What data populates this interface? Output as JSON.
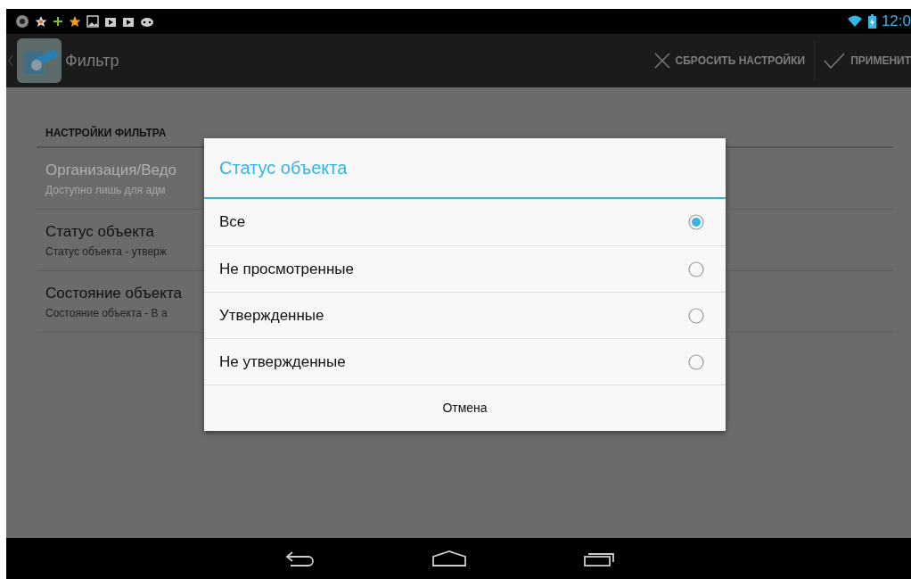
{
  "status_bar": {
    "time": "12:0"
  },
  "action_bar": {
    "title": "Фильтр",
    "actions": [
      {
        "kind": "reset",
        "label": "СБРОСИТЬ НАСТРОЙКИ"
      },
      {
        "kind": "apply",
        "label": "ПРИМЕНИТ"
      }
    ]
  },
  "settings": {
    "header": "НАСТРОЙКИ ФИЛЬТРА",
    "items": [
      {
        "title": "Организация/Ведо",
        "summary": "Доступно лишь для адм",
        "disabled": true
      },
      {
        "title": "Статус объекта",
        "summary": "Статус объекта - утверж",
        "disabled": false
      },
      {
        "title": "Состояние объекта",
        "summary": "Состояние объекта - В а",
        "disabled": false
      }
    ]
  },
  "dialog": {
    "title": "Статус объекта",
    "options": [
      {
        "label": "Все",
        "selected": true
      },
      {
        "label": "Не просмотренные",
        "selected": false
      },
      {
        "label": "Утвержденные",
        "selected": false
      },
      {
        "label": "Не утвержденные",
        "selected": false
      }
    ],
    "cancel": "Отмена"
  }
}
